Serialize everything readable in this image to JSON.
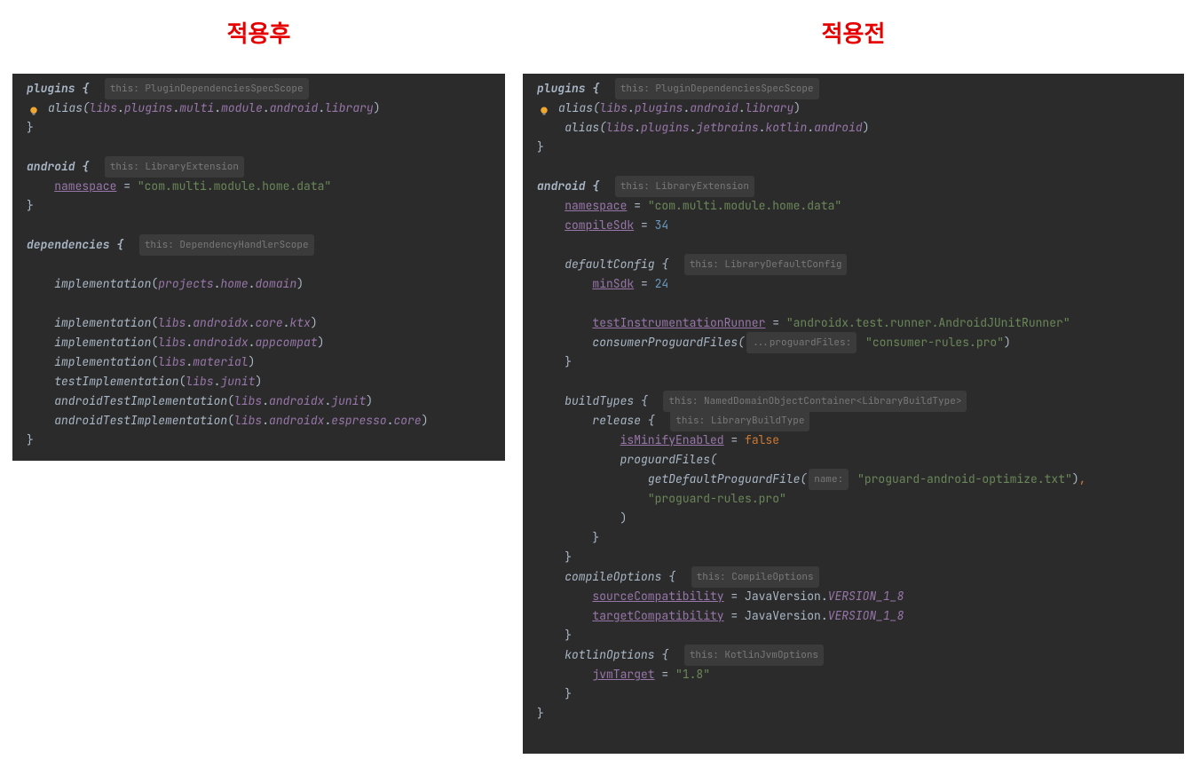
{
  "titles": {
    "after": "적용후",
    "before": "적용전"
  },
  "hints": {
    "pluginScope": "this: PluginDependenciesSpecScope",
    "libraryExt": "this: LibraryExtension",
    "depScope": "this: DependencyHandlerScope",
    "defaultConfig": "this: LibraryDefaultConfig",
    "proguardFiles": "...proguardFiles:",
    "buildTypes": "this: NamedDomainObjectContainer<LibraryBuildType>",
    "buildType": "this: LibraryBuildType",
    "compileOptions": "this: CompileOptions",
    "kotlinOptions": "this: KotlinJvmOptions",
    "proguardName": "name:"
  },
  "left": {
    "plugins": "plugins {",
    "alias1_parts": [
      "alias(",
      "libs",
      ".",
      "plugins",
      ".",
      "multi",
      ".",
      "module",
      ".",
      "android",
      ".",
      "library",
      ")"
    ],
    "close": "}",
    "android": "android {",
    "namespace": "namespace",
    "eq": " = ",
    "namespaceVal": "\"com.multi.module.home.data\"",
    "dependencies": "dependencies {",
    "impl": "implementation",
    "testImpl": "testImplementation",
    "androidTestImpl": "androidTestImplementation",
    "deps": {
      "projects_home_domain": [
        "projects",
        ".",
        "home",
        ".",
        "domain"
      ],
      "androidx_core_ktx": [
        "libs",
        ".",
        "androidx",
        ".",
        "core",
        ".",
        "ktx"
      ],
      "androidx_appcompat": [
        "libs",
        ".",
        "androidx",
        ".",
        "appcompat"
      ],
      "material": [
        "libs",
        ".",
        "material"
      ],
      "junit": [
        "libs",
        ".",
        "junit"
      ],
      "androidx_junit": [
        "libs",
        ".",
        "androidx",
        ".",
        "junit"
      ],
      "androidx_espresso": [
        "libs",
        ".",
        "androidx",
        ".",
        "espresso",
        ".",
        "core"
      ]
    }
  },
  "right": {
    "plugins": "plugins {",
    "alias1_parts": [
      "alias(",
      "libs",
      ".",
      "plugins",
      ".",
      "android",
      ".",
      "library",
      ")"
    ],
    "alias2_parts": [
      "alias(",
      "libs",
      ".",
      "plugins",
      ".",
      "jetbrains",
      ".",
      "kotlin",
      ".",
      "android",
      ")"
    ],
    "close": "}",
    "android": "android {",
    "namespace": "namespace",
    "namespaceVal": "\"com.multi.module.home.data\"",
    "compileSdk": "compileSdk",
    "compileSdkVal": "34",
    "defaultConfig": "defaultConfig {",
    "minSdk": "minSdk",
    "minSdkVal": "24",
    "testRunner": "testInstrumentationRunner",
    "testRunnerVal": "\"androidx.test.runner.AndroidJUnitRunner\"",
    "consumerProguard": "consumerProguardFiles(",
    "consumerProguardVal": "\"consumer-rules.pro\"",
    "buildTypes": "buildTypes {",
    "release": "release {",
    "isMinify": "isMinifyEnabled",
    "isMinifyVal": "false",
    "proguardFiles": "proguardFiles(",
    "getDefaultProguard": "getDefaultProguardFile(",
    "proguardOptimize": "\"proguard-android-optimize.txt\"",
    "proguardRules": "\"proguard-rules.pro\"",
    "compileOptions": "compileOptions {",
    "sourceCompat": "sourceCompatibility",
    "targetCompat": "targetCompatibility",
    "javaVersion": "JavaVersion",
    "version18": "VERSION_1_8",
    "kotlinOptions": "kotlinOptions {",
    "jvmTarget": "jvmTarget",
    "jvmTargetVal": "\"1.8\"",
    "eq": " = ",
    "paren_close": ")",
    "comma": ","
  }
}
